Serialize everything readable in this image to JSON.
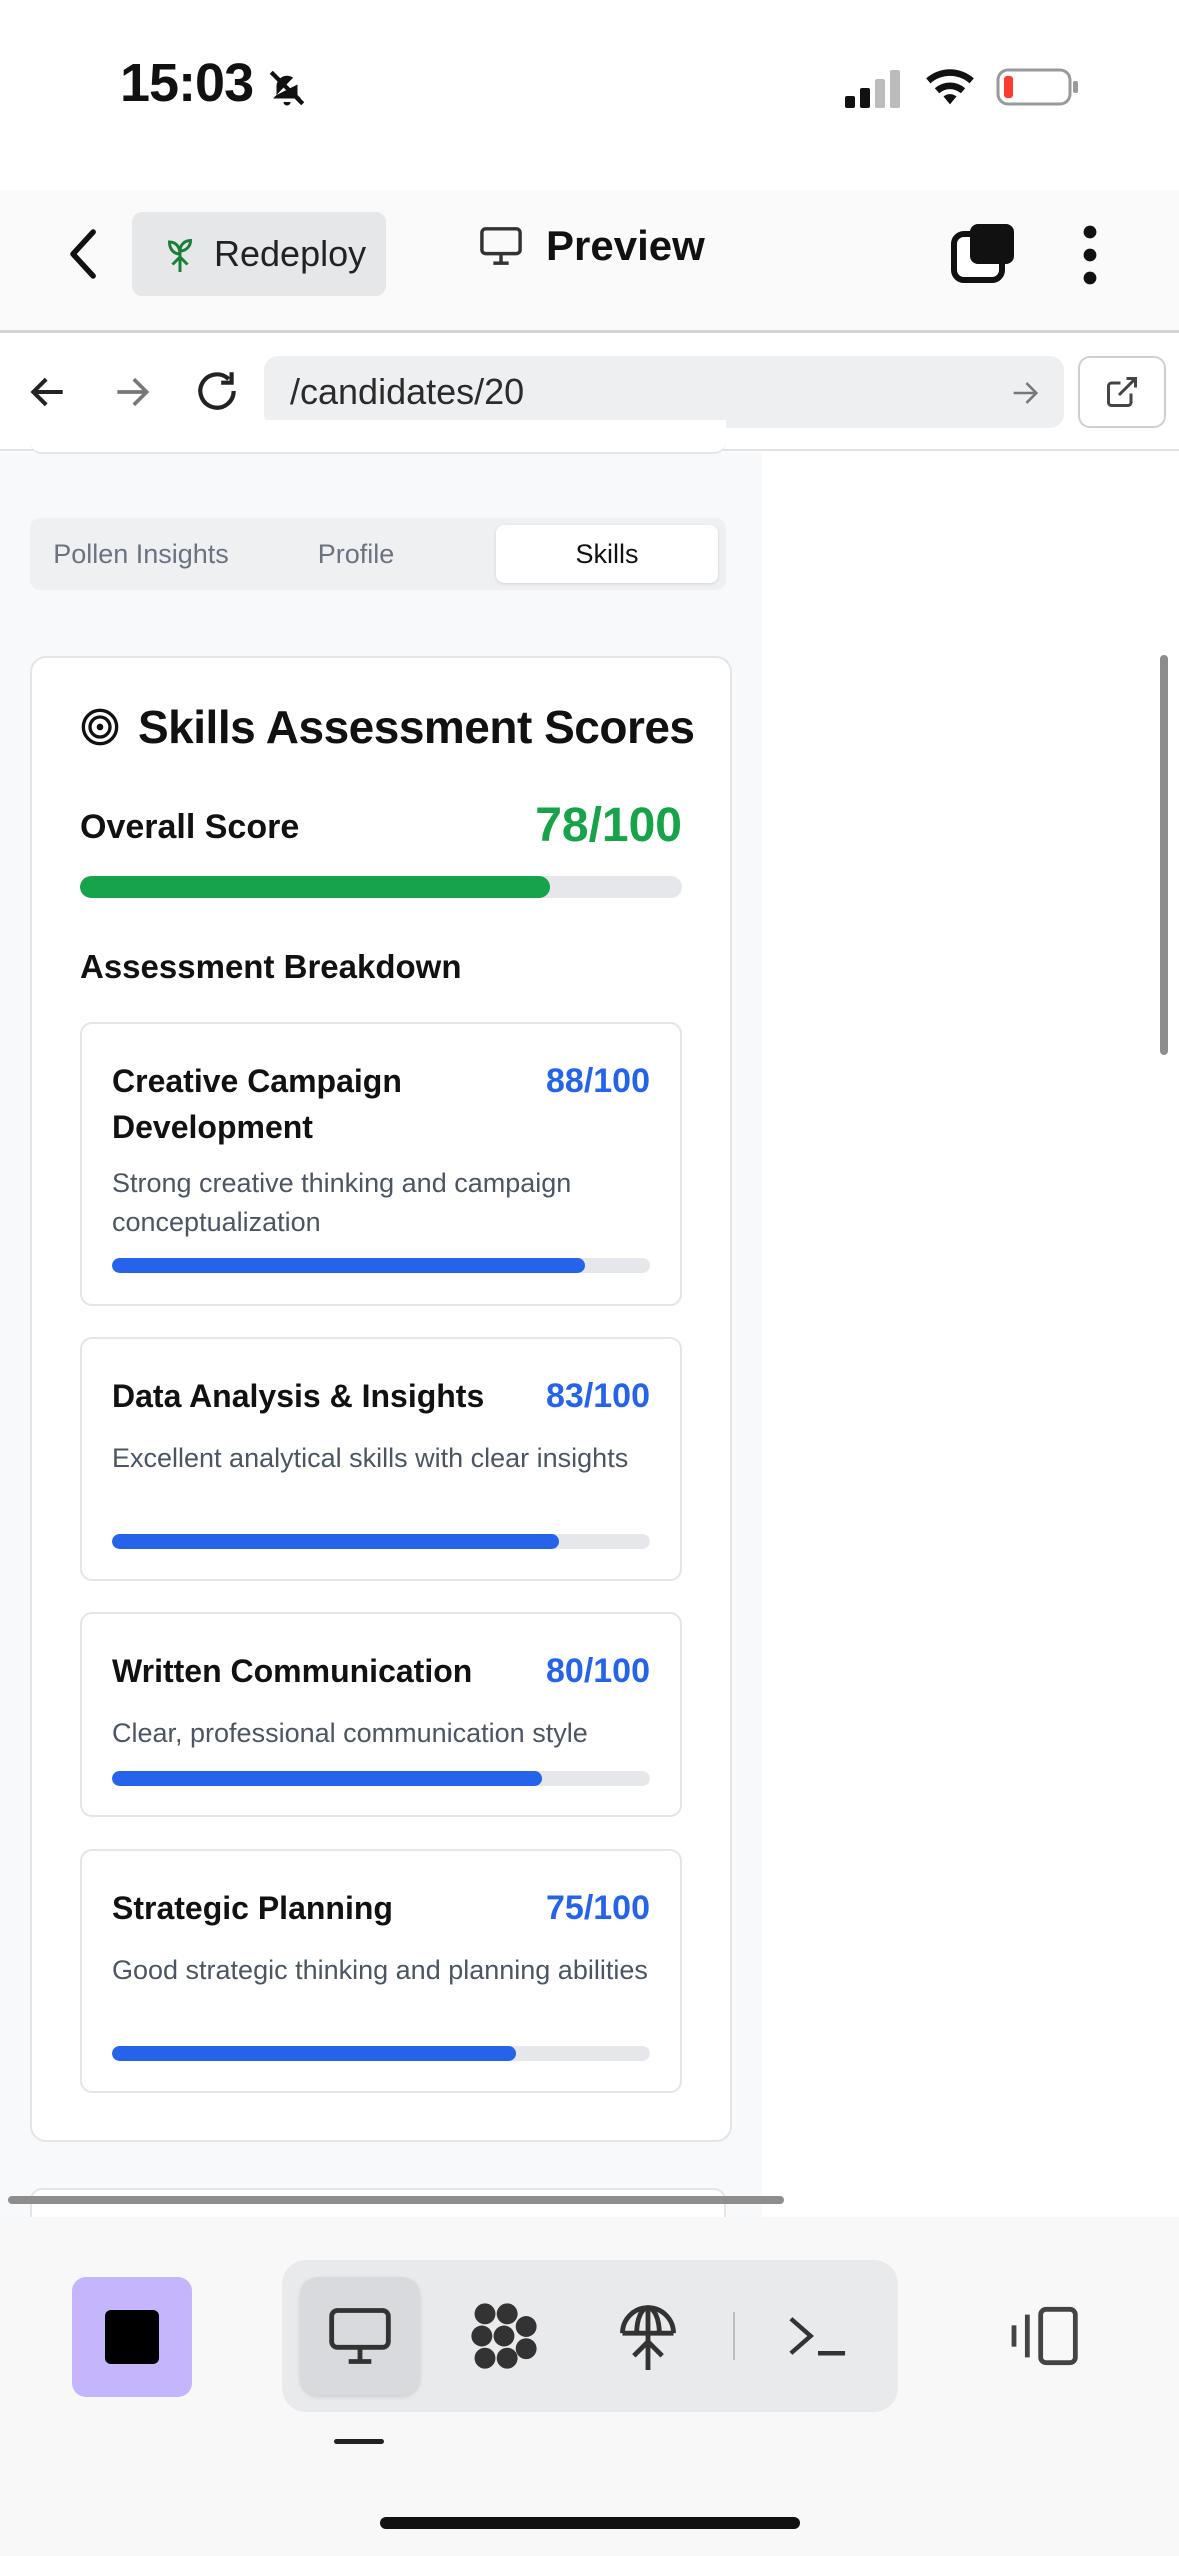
{
  "status_bar": {
    "time": "15:03",
    "icons": [
      "bell-slash-icon",
      "cellular-signal-icon",
      "wifi-icon",
      "battery-low-icon"
    ]
  },
  "top_nav": {
    "back_icon": "chevron-left-icon",
    "redeploy_label": "Redeploy",
    "preview_label": "Preview",
    "icons": [
      "sprout-icon",
      "monitor-icon",
      "tabs-icon",
      "more-vertical-icon"
    ]
  },
  "browser": {
    "url": "/candidates/20",
    "icons": [
      "arrow-left-icon",
      "arrow-right-icon",
      "reload-icon",
      "go-arrow-icon",
      "external-link-icon"
    ]
  },
  "tabs": [
    {
      "label": "Pollen Insights",
      "active": false
    },
    {
      "label": "Profile",
      "active": false
    },
    {
      "label": "Skills",
      "active": true
    }
  ],
  "skills_card": {
    "title": "Skills Assessment Scores",
    "overall_label": "Overall Score",
    "overall_score": "78/100",
    "overall_value": 78,
    "breakdown_title": "Assessment Breakdown",
    "items": [
      {
        "name": "Creative Campaign Development",
        "score": "88/100",
        "value": 88,
        "description": "Strong creative thinking and campaign conceptualization"
      },
      {
        "name": "Data Analysis & Insights",
        "score": "83/100",
        "value": 83,
        "description": "Excellent analytical skills with clear insights"
      },
      {
        "name": "Written Communication",
        "score": "80/100",
        "value": 80,
        "description": "Clear, professional communication style"
      },
      {
        "name": "Strategic Planning",
        "score": "75/100",
        "value": 75,
        "description": "Good strategic thinking and planning abilities"
      }
    ]
  },
  "colors": {
    "overall_bar": "#16a34a",
    "skill_bar": "#2563eb",
    "stop_button": "#c4b5fd"
  },
  "bottom_toolbar": {
    "icons": [
      "stop-icon",
      "desktop-preview-icon",
      "workflow-icon",
      "deploy-icon",
      "terminal-icon",
      "split-panel-icon"
    ]
  }
}
